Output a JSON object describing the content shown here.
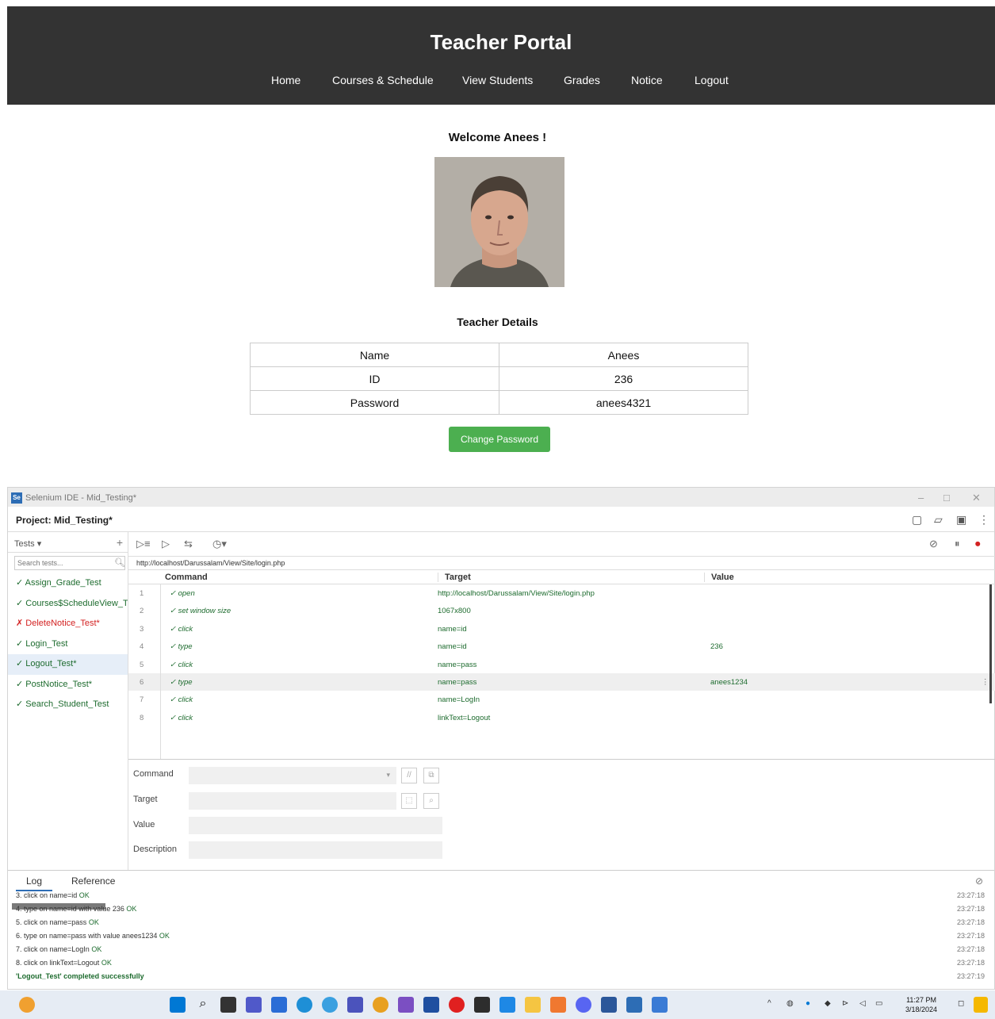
{
  "portal": {
    "title": "Teacher Portal",
    "nav": [
      "Home",
      "Courses & Schedule",
      "View Students",
      "Grades",
      "Notice",
      "Logout"
    ],
    "welcome": "Welcome Anees !",
    "details_heading": "Teacher Details",
    "details": [
      {
        "label": "Name",
        "value": "Anees"
      },
      {
        "label": "ID",
        "value": "236"
      },
      {
        "label": "Password",
        "value": "anees4321"
      }
    ],
    "change_password": "Change Password"
  },
  "ide": {
    "window_title": "Selenium IDE - Mid_Testing*",
    "project": "Project:  Mid_Testing*",
    "tests_label": "Tests",
    "search_placeholder": "Search tests...",
    "tests": [
      {
        "name": "✓ Assign_Grade_Test",
        "status": "pass"
      },
      {
        "name": "✓ Courses$ScheduleView_T",
        "status": "pass"
      },
      {
        "name": "✗ DeleteNotice_Test*",
        "status": "fail"
      },
      {
        "name": "✓ Login_Test",
        "status": "pass"
      },
      {
        "name": "✓ Logout_Test*",
        "status": "pass"
      },
      {
        "name": "✓ PostNotice_Test*",
        "status": "pass"
      },
      {
        "name": "✓ Search_Student_Test",
        "status": "pass"
      }
    ],
    "url": "http://localhost/Darussalam/View/Site/login.php",
    "columns": {
      "command": "Command",
      "target": "Target",
      "value": "Value"
    },
    "commands": [
      {
        "n": "1",
        "cmd": "✓ open",
        "target": "http://localhost/Darussalam/View/Site/login.php",
        "value": ""
      },
      {
        "n": "2",
        "cmd": "✓ set window size",
        "target": "1067x800",
        "value": ""
      },
      {
        "n": "3",
        "cmd": "✓ click",
        "target": "name=id",
        "value": ""
      },
      {
        "n": "4",
        "cmd": "✓ type",
        "target": "name=id",
        "value": "236"
      },
      {
        "n": "5",
        "cmd": "✓ click",
        "target": "name=pass",
        "value": ""
      },
      {
        "n": "6",
        "cmd": "✓ type",
        "target": "name=pass",
        "value": "anees1234"
      },
      {
        "n": "7",
        "cmd": "✓ click",
        "target": "name=LogIn",
        "value": ""
      },
      {
        "n": "8",
        "cmd": "✓ click",
        "target": "linkText=Logout",
        "value": ""
      }
    ],
    "editor": {
      "command": "Command",
      "target": "Target",
      "value": "Value",
      "description": "Description"
    },
    "log_tabs": [
      "Log",
      "Reference"
    ],
    "logs": [
      {
        "msg": "3.  click on name=id ",
        "status": "OK",
        "time": "23:27:18"
      },
      {
        "msg": "4.  type on name=id with value 236 ",
        "status": "OK",
        "time": "23:27:18"
      },
      {
        "msg": "5.  click on name=pass ",
        "status": "OK",
        "time": "23:27:18"
      },
      {
        "msg": "6.  type on name=pass with value anees1234 ",
        "status": "OK",
        "time": "23:27:18"
      },
      {
        "msg": "7.  click on name=LogIn ",
        "status": "OK",
        "time": "23:27:18"
      },
      {
        "msg": "8.  click on linkText=Logout ",
        "status": "OK",
        "time": "23:27:18"
      }
    ],
    "final_log": {
      "msg": "'Logout_Test' completed successfully",
      "time": "23:27:19"
    }
  },
  "taskbar": {
    "time": "11:27 PM",
    "date": "3/18/2024"
  },
  "colors": {
    "header_bg": "#333333",
    "button_green": "#4caf50",
    "pass_green": "#1d6b2e",
    "fail_red": "#d32121"
  }
}
